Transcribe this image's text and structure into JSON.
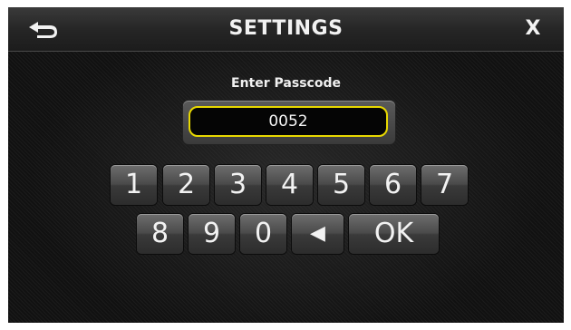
{
  "header": {
    "title": "SETTINGS",
    "back_icon": "return-arrow-icon",
    "close_label": "X"
  },
  "passcode": {
    "prompt": "Enter Passcode",
    "value": "0052",
    "border_color": "#e8d800"
  },
  "keypad": {
    "row1": [
      "1",
      "2",
      "3",
      "4",
      "5",
      "6",
      "7"
    ],
    "row2": [
      "8",
      "9",
      "0"
    ],
    "backspace_label": "◀",
    "ok_label": "OK"
  }
}
